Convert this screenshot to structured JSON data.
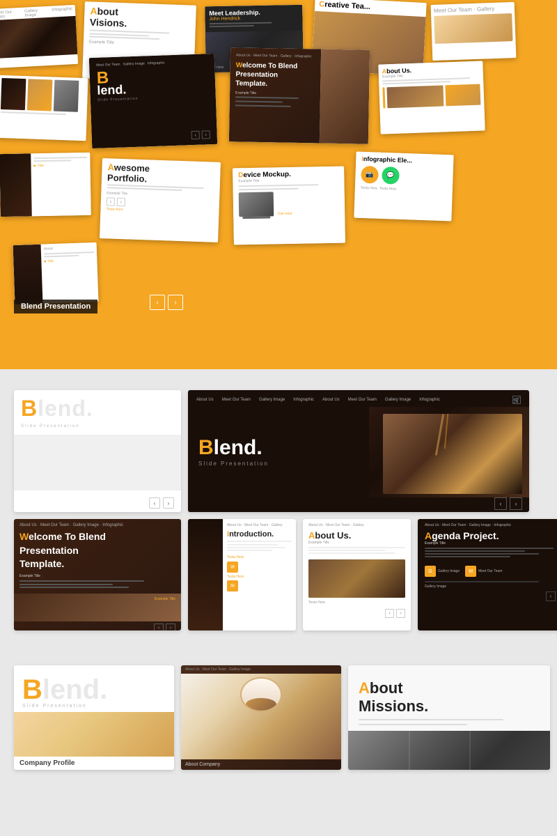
{
  "brand": {
    "name": "Blend",
    "dot": ".",
    "subtitle": "Slide Presentation",
    "label": "Blend Presentation"
  },
  "nav": {
    "items": [
      "About Us",
      "Meet Our Team",
      "Gallery Image",
      "Infographic"
    ]
  },
  "slides": {
    "about_visions": {
      "title": "About",
      "title2": "Visions.",
      "example": "Example Title"
    },
    "meet_leadership": {
      "title": "Meet Leadership.",
      "name": "John Hendrick"
    },
    "creative_team": {
      "title": "Creative Tea..."
    },
    "welcome": {
      "line1": "Welcome To Blend",
      "line2": "Presentation",
      "line3": "Template."
    },
    "about_us": {
      "title": "About Us.",
      "example": "Example Title"
    },
    "device_mockup": {
      "title": "Device Mockup.",
      "example": "Example Title"
    },
    "infographic": {
      "title": "Infographic Ele..."
    },
    "awesome_portfolio": {
      "title": "Awesome",
      "title2": "Portfolio."
    },
    "introduction": {
      "title": "Introduction."
    },
    "agenda": {
      "title": "Agenda Project.",
      "example": "Example Title"
    },
    "company_profile": {
      "title": "Company Profile"
    },
    "about_company": {
      "title": "About Company"
    },
    "about_missions": {
      "title": "About",
      "title2": "Missions."
    }
  },
  "colors": {
    "accent": "#f5a623",
    "dark": "#1a0e08",
    "text_primary": "#222222",
    "text_secondary": "#999999",
    "bg_light": "#e8e8e8",
    "white": "#ffffff"
  },
  "preview_section": {
    "row1": {
      "left_label": "Blend.",
      "right_nav_label": "About Us  Meet Our Team  Gallery Image  Infographic"
    }
  },
  "bottom_section": {
    "cards": [
      {
        "title": "Introduction.",
        "accent_char": "I"
      },
      {
        "title": "About Us.",
        "accent_char": "A"
      },
      {
        "title": "Agenda Project.",
        "accent_char": "A"
      }
    ]
  },
  "footer_section": {
    "cards": [
      {
        "label": "Company Profile"
      },
      {
        "label": "About Company"
      },
      {
        "title": "About",
        "title2": "Missions."
      }
    ]
  }
}
